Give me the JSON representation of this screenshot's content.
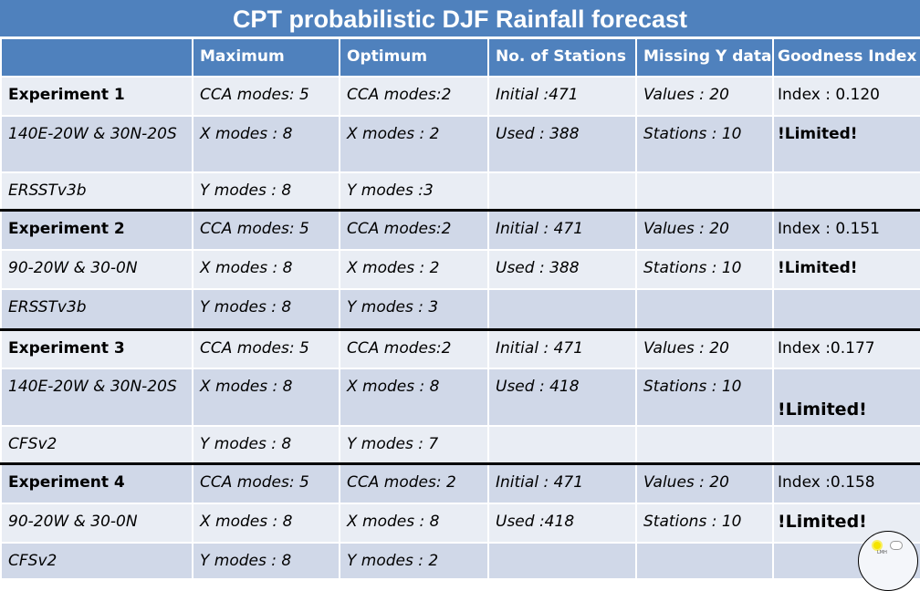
{
  "title": "CPT probabilistic DJF Rainfall forecast",
  "columns": [
    "",
    "Maximum",
    "Optimum",
    "No. of Stations",
    "Missing Y data",
    "Goodness Index"
  ],
  "experiments": [
    {
      "rows": [
        [
          "Experiment 1",
          "CCA modes: 5",
          "CCA modes:2",
          "Initial :471",
          "Values : 20",
          "Index : 0.120"
        ],
        [
          "140E-20W & 30N-20S",
          "X modes : 8",
          "X modes : 2",
          "Used : 388",
          "Stations : 10",
          "!Limited!"
        ],
        [
          "ERSSTv3b",
          "Y modes : 8",
          "Y modes :3",
          "",
          "",
          ""
        ]
      ]
    },
    {
      "rows": [
        [
          "Experiment 2",
          "CCA modes: 5",
          "CCA modes:2",
          "Initial : 471",
          "Values : 20",
          "Index : 0.151"
        ],
        [
          "90-20W & 30-0N",
          "X modes : 8",
          "X modes : 2",
          "Used : 388",
          "Stations : 10",
          "!Limited!"
        ],
        [
          "ERSSTv3b",
          "Y modes : 8",
          "Y modes : 3",
          "",
          "",
          ""
        ]
      ]
    },
    {
      "rows": [
        [
          "Experiment 3",
          "CCA modes: 5",
          "CCA modes:2",
          "Initial : 471",
          "Values : 20",
          "Index :0.177"
        ],
        [
          "140E-20W & 30N-20S",
          "X modes : 8",
          "X modes : 8",
          "Used : 418",
          "Stations : 10",
          "!Limited!"
        ],
        [
          "CFSv2",
          "Y modes : 8",
          "Y modes : 7",
          "",
          "",
          ""
        ]
      ]
    },
    {
      "rows": [
        [
          "Experiment 4",
          "CCA modes: 5",
          "CCA modes: 2",
          "Initial : 471",
          "Values : 20",
          "Index :0.158"
        ],
        [
          "90-20W & 30-0N",
          "X modes : 8",
          "X modes : 8",
          "Used :418",
          "Stations : 10",
          "!Limited!"
        ],
        [
          "CFSv2",
          "Y modes : 8",
          "Y modes : 2",
          "",
          "",
          ""
        ]
      ]
    }
  ],
  "logo": {
    "text": "LMH",
    "icon": "sun-cloud-logo-icon"
  },
  "colors": {
    "header": "#4f81bd",
    "row_dark": "#d0d8e8",
    "row_light": "#e9edf4",
    "separator": "#000000"
  }
}
